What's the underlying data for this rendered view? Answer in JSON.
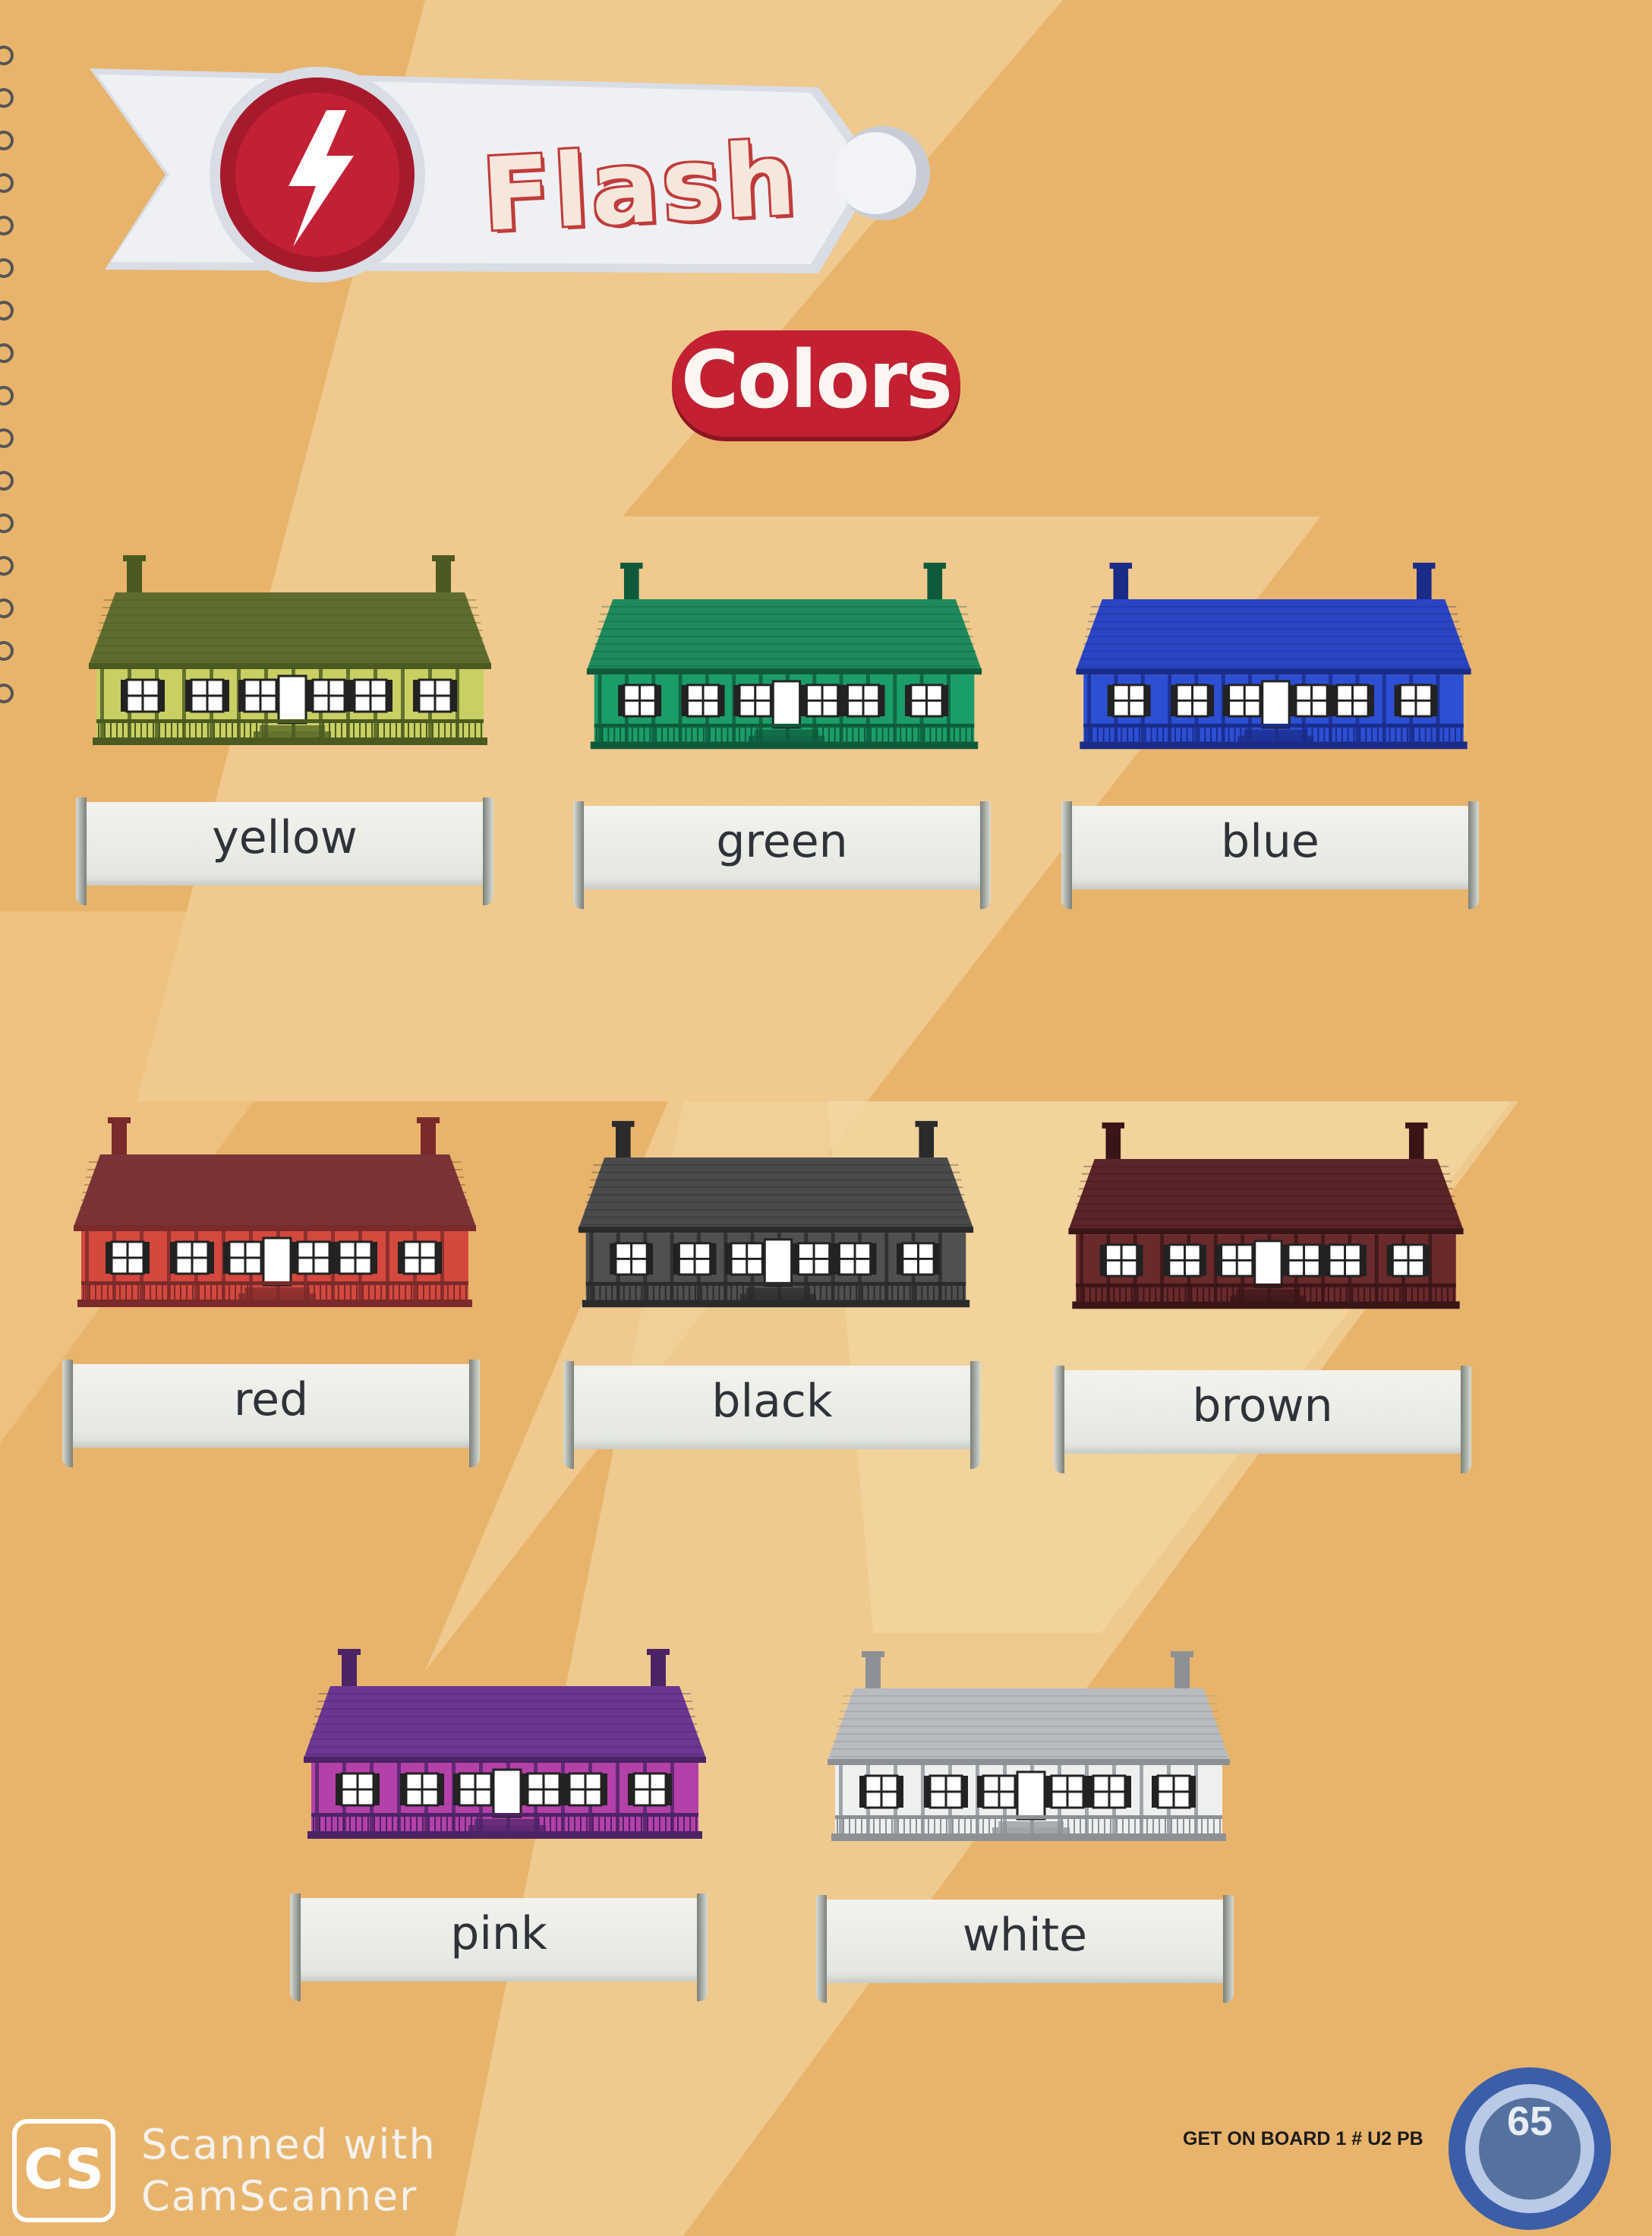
{
  "banner": {
    "title": "Flash",
    "icon": "lightning-bolt-icon"
  },
  "heading": "Colors",
  "houses": [
    {
      "label": "yellow",
      "roof": "#5f6c2f",
      "wall": "#c9cf62",
      "trim": "#4a5a20"
    },
    {
      "label": "green",
      "roof": "#1e8a5d",
      "wall": "#1b9d6a",
      "trim": "#0e5a3b"
    },
    {
      "label": "blue",
      "roof": "#2945c4",
      "wall": "#2c4fd3",
      "trim": "#1a2b88"
    },
    {
      "label": "red",
      "roof": "#7a3438",
      "wall": "#d4483d",
      "trim": "#7a2a2a"
    },
    {
      "label": "black",
      "roof": "#4a4b4d",
      "wall": "#505052",
      "trim": "#2b2b2c"
    },
    {
      "label": "brown",
      "roof": "#5a2428",
      "wall": "#6a2a2c",
      "trim": "#3a1517"
    },
    {
      "label": "pink",
      "roof": "#6b3792",
      "wall": "#b440a9",
      "trim": "#4c2365"
    },
    {
      "label": "white",
      "roof": "#b8bcc0",
      "wall": "#eef0f0",
      "trim": "#8d9196"
    }
  ],
  "footer": {
    "book": "GET ON BOARD 1 # U2 PB",
    "page": "65"
  },
  "watermark": {
    "logo": "CS",
    "line1": "Scanned with",
    "line2": "CamScanner"
  }
}
